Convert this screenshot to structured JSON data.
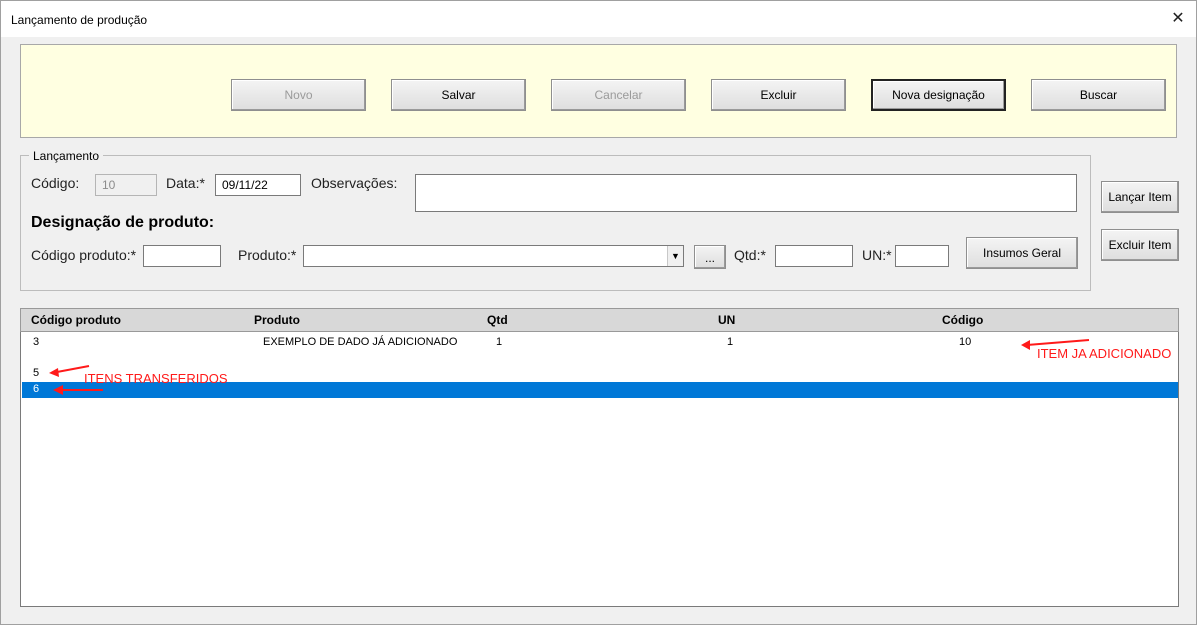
{
  "window": {
    "title": "Lançamento de produção",
    "close_glyph": "✕"
  },
  "toolbar": {
    "novo": "Novo",
    "salvar": "Salvar",
    "cancelar": "Cancelar",
    "excluir": "Excluir",
    "nova_designacao": "Nova designação",
    "buscar": "Buscar"
  },
  "lancamento": {
    "legend": "Lançamento",
    "codigo_label": "Código:",
    "codigo_value": "10",
    "data_label": "Data:*",
    "data_value": "09/11/22",
    "observacoes_label": "Observações:",
    "observacoes_value": "",
    "designacao_title": "Designação de produto:",
    "codigo_produto_label": "Código produto:*",
    "codigo_produto_value": "",
    "produto_label": "Produto:*",
    "produto_value": "",
    "ellipsis_button": "...",
    "qtd_label": "Qtd:*",
    "qtd_value": "",
    "un_label": "UN:*",
    "un_value": "",
    "insumos_button": "Insumos Geral"
  },
  "side_buttons": {
    "lancar_item": "Lançar Item",
    "excluir_item": "Excluir Item"
  },
  "list": {
    "columns": [
      "Código produto",
      "Produto",
      "Qtd",
      "UN",
      "Código"
    ],
    "rows": [
      {
        "codigo_produto": "3",
        "produto": "EXEMPLO DE DADO JÁ ADICIONADO",
        "qtd": "1",
        "un": "1",
        "codigo": "10"
      },
      {
        "codigo_produto": "5",
        "produto": "",
        "qtd": "",
        "un": "",
        "codigo": ""
      },
      {
        "codigo_produto": "6",
        "produto": "",
        "qtd": "",
        "un": "",
        "codigo": "",
        "selected": true
      }
    ]
  },
  "annotations": {
    "item_ja_adicionado": "ITEM JA ADICIONADO",
    "itens_transferidos": "ITENS TRANSFERIDOS",
    "color": "#ff1a1a"
  },
  "colors": {
    "toolbar_bg": "#ffffe1",
    "selection": "#0078d7",
    "header_bg": "#d8d8d8"
  }
}
